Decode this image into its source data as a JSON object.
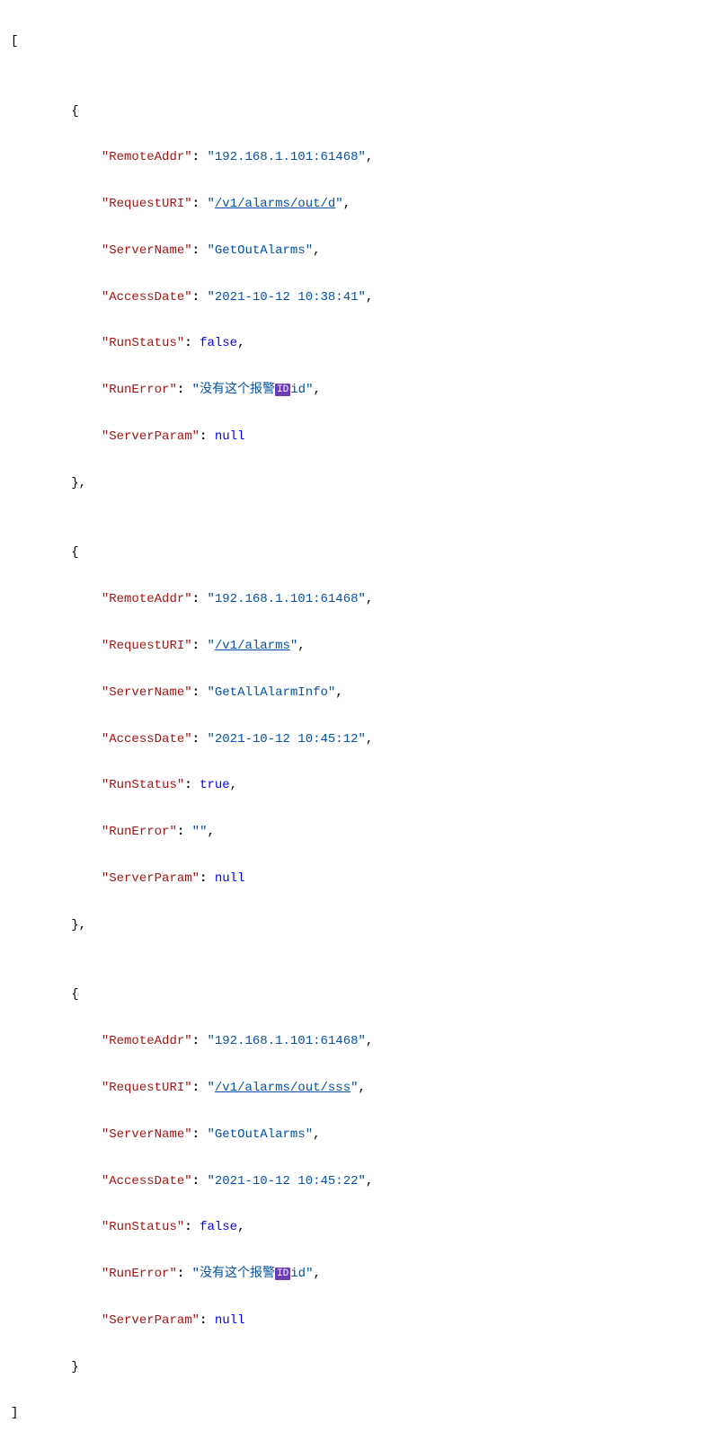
{
  "array_open": "[",
  "array_close": "]",
  "brace_open": "{",
  "brace_close_comma": "},",
  "brace_close": "}",
  "comma": ",",
  "id_badge_text": "ID",
  "keys": {
    "RemoteAddr": "\"RemoteAddr\"",
    "RequestURI": "\"RequestURI\"",
    "ServerName": "\"ServerName\"",
    "AccessDate": "\"AccessDate\"",
    "RunStatus": "\"RunStatus\"",
    "RunError": "\"RunError\"",
    "ServerParam": "\"ServerParam\""
  },
  "records": [
    {
      "RemoteAddr": "192.168.1.101:61468",
      "RequestURI": "/v1/alarms/out/d",
      "ServerName": "GetOutAlarms",
      "AccessDate": "2021-10-12 10:38:41",
      "RunStatus": "false",
      "RunError_pre": "没有这个报警",
      "RunError_post": "id",
      "RunError_has_badge": true,
      "ServerParam": "null"
    },
    {
      "RemoteAddr": "192.168.1.101:61468",
      "RequestURI": "/v1/alarms",
      "ServerName": "GetAllAlarmInfo",
      "AccessDate": "2021-10-12 10:45:12",
      "RunStatus": "true",
      "RunError_pre": "",
      "RunError_post": "",
      "RunError_has_badge": false,
      "ServerParam": "null"
    },
    {
      "RemoteAddr": "192.168.1.101:61468",
      "RequestURI": "/v1/alarms/out/sss",
      "ServerName": "GetOutAlarms",
      "AccessDate": "2021-10-12 10:45:22",
      "RunStatus": "false",
      "RunError_pre": "没有这个报警",
      "RunError_post": "id",
      "RunError_has_badge": true,
      "ServerParam": "null"
    }
  ]
}
